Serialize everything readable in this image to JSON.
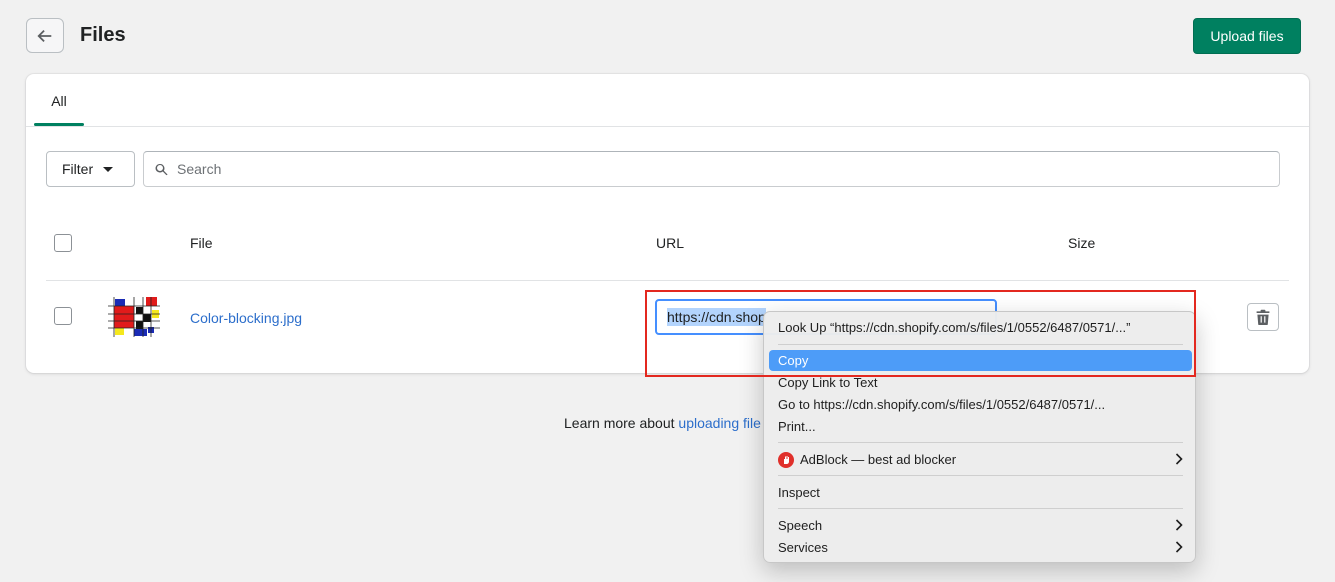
{
  "header": {
    "title": "Files",
    "upload_label": "Upload files"
  },
  "tabs": [
    {
      "label": "All"
    }
  ],
  "toolbar": {
    "filter_label": "Filter",
    "search_placeholder": "Search"
  },
  "table": {
    "columns": [
      "File",
      "URL",
      "Size"
    ],
    "rows": [
      {
        "file_name": "Color-blocking.jpg",
        "url_visible": "https://cdn.shop",
        "size": ""
      }
    ]
  },
  "footer": {
    "learn_prefix": "Learn more about ",
    "learn_link": "uploading file"
  },
  "context_menu": {
    "items": [
      {
        "label": "Look Up “https://cdn.shopify.com/s/files/1/0552/6487/0571/...”"
      },
      {
        "label": "Copy",
        "highlighted": true
      },
      {
        "label": "Copy Link to Text"
      },
      {
        "label": "Go to https://cdn.shopify.com/s/files/1/0552/6487/0571/..."
      },
      {
        "label": "Print..."
      },
      {
        "label": "AdBlock — best ad blocker",
        "submenu": true
      },
      {
        "label": "Inspect"
      },
      {
        "label": "Speech",
        "submenu": true
      },
      {
        "label": "Services",
        "submenu": true
      }
    ]
  },
  "colors": {
    "primary": "#008060",
    "link": "#2c6ecb",
    "menu_highlight": "#4d9cf8",
    "annotation": "#e3281f"
  },
  "icons": [
    "arrow-left-icon",
    "search-icon",
    "caret-down-icon",
    "trash-icon",
    "adblock-hand-icon",
    "chevron-right-icon"
  ]
}
